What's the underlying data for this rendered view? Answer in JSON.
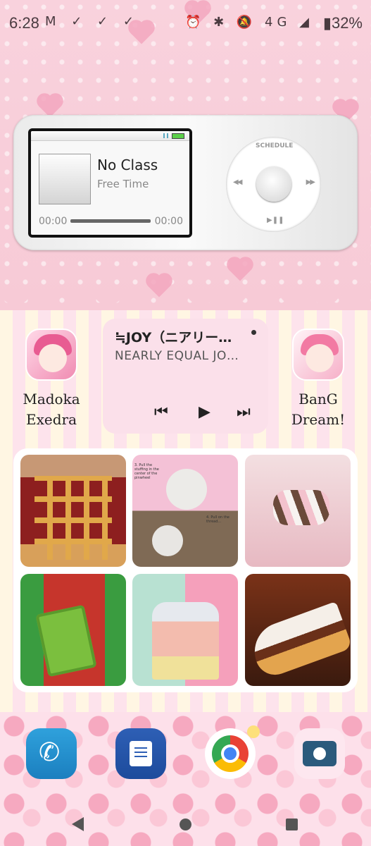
{
  "status_bar": {
    "time": "6:28",
    "notification_icons": [
      "gmail-icon",
      "task-check-icon",
      "task-check-icon",
      "task-check-icon"
    ],
    "notification_glyphs": "M ✓ ✓ ✓",
    "system_icons": [
      "alarm-icon",
      "bluetooth-icon",
      "mute-icon",
      "4g-lte-icon",
      "signal-icon"
    ],
    "system_glyphs": "⏰ ✱ 🔕 4G ◢",
    "battery": "32%"
  },
  "ipod_widget": {
    "song_title": "No Class",
    "artist": "Free Time",
    "time_elapsed": "00:00",
    "time_remaining": "00:00",
    "wheel_menu_label": "SCHEDULE",
    "wheel_prev": "◀◀",
    "wheel_next": "▶▶",
    "wheel_play": "▶❚❚"
  },
  "apps": {
    "left": {
      "label": "Madoka\nExedra"
    },
    "right": {
      "label": "BanG\nDream!"
    }
  },
  "music_widget": {
    "title": "≒JOY（ニアリー…",
    "subtitle": "NEARLY EQUAL JO…",
    "prev": "⏮",
    "play": "▶",
    "next": "⏭"
  },
  "photo_widget": {
    "photo2_caption_top": "3. Pull the stuffing in the center of the pinwheel",
    "photo2_caption_bottom": "4. Pull on the thread..."
  },
  "dock": [
    "phone-icon",
    "messages-icon",
    "chrome-icon",
    "camera-icon"
  ],
  "colors": {
    "wallpaper_pink": "#f7cad6",
    "widget_pink": "#fbe0ea",
    "phone_blue": "#2fa1dc",
    "messages_blue": "#2e5fb5"
  }
}
